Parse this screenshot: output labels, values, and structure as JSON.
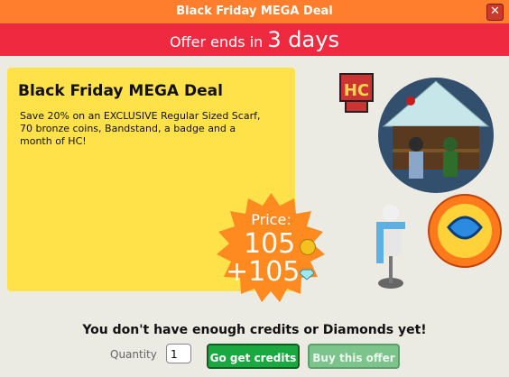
{
  "window": {
    "title": "Black Friday MEGA Deal",
    "close_label": "✕"
  },
  "offer": {
    "prefix": "Offer ends in",
    "time": "3 days"
  },
  "card": {
    "title": "Black Friday MEGA Deal",
    "description": "Save 20% on an EXCLUSIVE Regular Sized Scarf, 70 bronze coins, Bandstand, a badge and a month of HC!"
  },
  "price": {
    "label": "Price:",
    "credits": "105",
    "diamonds": "+105"
  },
  "message": "You don't have enough credits or Diamonds yet!",
  "quantity": {
    "label": "Quantity",
    "value": "1"
  },
  "buttons": {
    "get_credits": "Go get credits",
    "buy": "Buy this offer"
  },
  "badge": {
    "text": "HC"
  },
  "colors": {
    "titlebar": "#ff7e2d",
    "offerbar": "#ef2a40",
    "card": "#ffe14a",
    "burst": "#ff8a1f",
    "primary_button": "#1aa841"
  }
}
